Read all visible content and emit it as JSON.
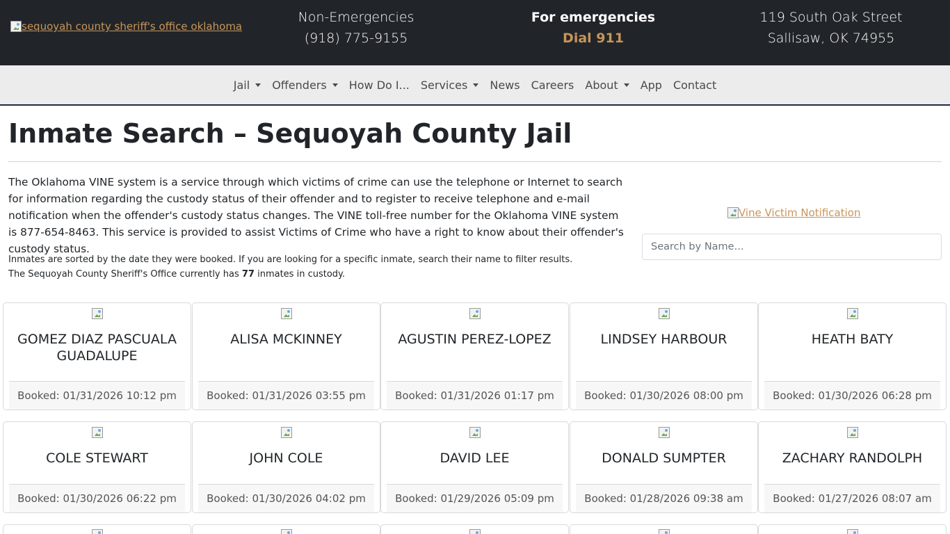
{
  "header": {
    "logo_alt": "sequoyah county sheriff's office oklahoma",
    "non_emergencies_label": "Non-Emergencies",
    "non_emergencies_phone": "(918) 775-9155",
    "emergencies_label": "For emergencies",
    "emergencies_dial": "Dial 911",
    "address_line1": "119 South Oak Street",
    "address_line2": "Sallisaw, OK 74955"
  },
  "nav": {
    "items": [
      {
        "label": "Jail",
        "dropdown": true
      },
      {
        "label": "Offenders",
        "dropdown": true
      },
      {
        "label": "How Do I...",
        "dropdown": false
      },
      {
        "label": "Services",
        "dropdown": true
      },
      {
        "label": "News",
        "dropdown": false
      },
      {
        "label": "Careers",
        "dropdown": false
      },
      {
        "label": "About",
        "dropdown": true
      },
      {
        "label": "App",
        "dropdown": false
      },
      {
        "label": "Contact",
        "dropdown": false
      }
    ]
  },
  "main": {
    "title": "Inmate Search – Sequoyah County Jail",
    "intro": "The Oklahoma VINE system is a service through which victims of crime can use the telephone or Internet to search for information regarding the custody status of their offender and to register to receive telephone and e-mail notification when the offender's custody status changes. The VINE toll-free number for the Oklahoma VINE system is 877-654-8463. This service is provided to assist Victims of Crime who have a right to know about their offender's custody status.",
    "note_line1": "Inmates are sorted by the date they were booked. If you are looking for a specific inmate, search their name to filter results.",
    "note_line2_prefix": "The Sequoyah County Sheriff's Office currently has ",
    "inmate_count": "77",
    "note_line2_suffix": " inmates in custody.",
    "vine_alt": "Vine Victim Notification",
    "search_placeholder": "Search by Name..."
  },
  "inmates": [
    {
      "name": "GOMEZ DIAZ PASCUALA GUADALUPE",
      "booked": "Booked: 01/31/2026 10:12 pm"
    },
    {
      "name": "ALISA MCKINNEY",
      "booked": "Booked: 01/31/2026 03:55 pm"
    },
    {
      "name": "AGUSTIN PEREZ-LOPEZ",
      "booked": "Booked: 01/31/2026 01:17 pm"
    },
    {
      "name": "LINDSEY HARBOUR",
      "booked": "Booked: 01/30/2026 08:00 pm"
    },
    {
      "name": "HEATH BATY",
      "booked": "Booked: 01/30/2026 06:28 pm"
    },
    {
      "name": "COLE STEWART",
      "booked": "Booked: 01/30/2026 06:22 pm"
    },
    {
      "name": "JOHN COLE",
      "booked": "Booked: 01/30/2026 04:02 pm"
    },
    {
      "name": "DAVID LEE",
      "booked": "Booked: 01/29/2026 05:09 pm"
    },
    {
      "name": "DONALD SUMPTER",
      "booked": "Booked: 01/28/2026 09:38 am"
    },
    {
      "name": "ZACHARY RANDOLPH",
      "booked": "Booked: 01/27/2026 08:07 am"
    }
  ],
  "colors": {
    "header_bg": "#212529",
    "accent": "#c8955a",
    "nav_bg": "#ececec"
  }
}
